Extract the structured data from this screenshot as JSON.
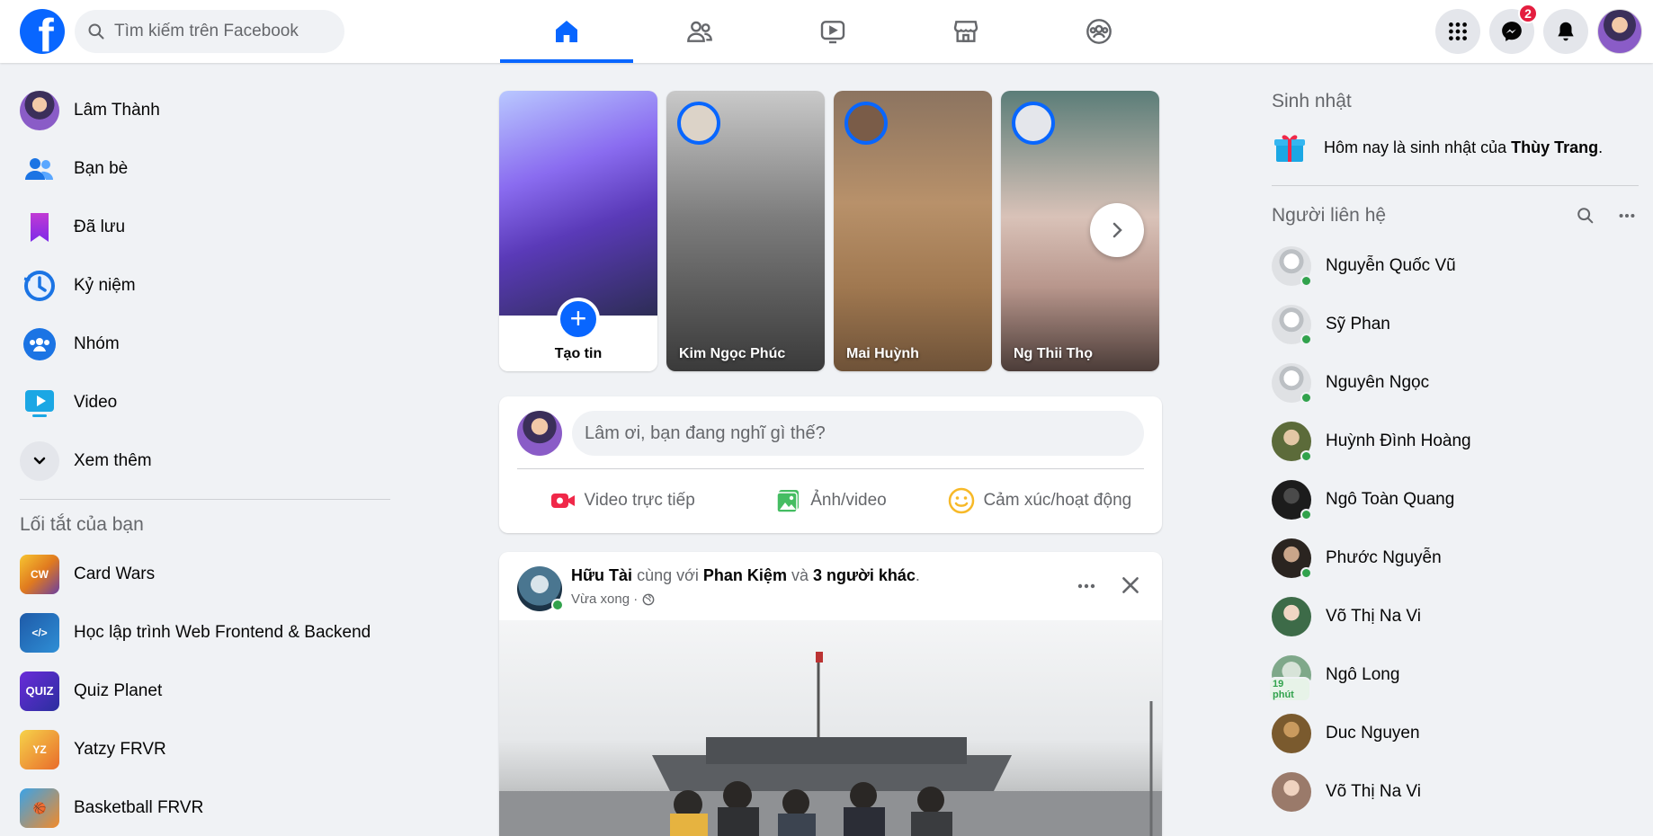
{
  "search": {
    "placeholder": "Tìm kiếm trên Facebook"
  },
  "nav": {
    "tabs": [
      "home",
      "friends",
      "watch",
      "marketplace",
      "groups"
    ],
    "active": "home"
  },
  "header": {
    "messenger_badge": "2"
  },
  "sidebar": {
    "items": [
      {
        "label": "Lâm Thành"
      },
      {
        "label": "Bạn bè"
      },
      {
        "label": "Đã lưu"
      },
      {
        "label": "Kỷ niệm"
      },
      {
        "label": "Nhóm"
      },
      {
        "label": "Video"
      },
      {
        "label": "Xem thêm"
      }
    ],
    "shortcuts_title": "Lối tắt của bạn",
    "shortcuts": [
      {
        "label": "Card Wars"
      },
      {
        "label": "Học lập trình Web Frontend & Backend"
      },
      {
        "label": "Quiz Planet"
      },
      {
        "label": "Yatzy FRVR"
      },
      {
        "label": "Basketball FRVR"
      }
    ]
  },
  "stories": {
    "create_label": "Tạo tin",
    "items": [
      {
        "name": "Kim Ngọc Phúc"
      },
      {
        "name": "Mai Huỳnh"
      },
      {
        "name": "Ng Thii Thọ"
      }
    ]
  },
  "composer": {
    "placeholder": "Lâm ơi, bạn đang nghĩ gì thế?",
    "live": "Video trực tiếp",
    "photo": "Ảnh/video",
    "feeling": "Cảm xúc/hoạt động"
  },
  "post": {
    "author": "Hữu Tài",
    "with_text": "cùng với",
    "tagged": "Phan Kiệm",
    "and_text": "và",
    "others": "3 người khác",
    "time": "Vừa xong ·"
  },
  "rightbar": {
    "birthday_title": "Sinh nhật",
    "birthday_prefix": "Hôm nay là sinh nhật của",
    "birthday_name": "Thùy Trang",
    "contacts_title": "Người liên hệ",
    "contacts": [
      {
        "name": "Nguyễn Quốc Vũ"
      },
      {
        "name": "Sỹ Phan"
      },
      {
        "name": "Nguyên Ngọc"
      },
      {
        "name": "Huỳnh Đình Hoàng"
      },
      {
        "name": "Ngô Toàn Quang"
      },
      {
        "name": "Phước Nguyễn"
      },
      {
        "name": "Võ Thị Na Vi"
      },
      {
        "name": "Ngô Long",
        "status": "19 phút"
      },
      {
        "name": "Duc Nguyen"
      },
      {
        "name": "Võ Thị Na Vi"
      }
    ]
  },
  "colors": {
    "brand": "#0866ff",
    "online": "#31a24c",
    "badge": "#e41e3f"
  }
}
